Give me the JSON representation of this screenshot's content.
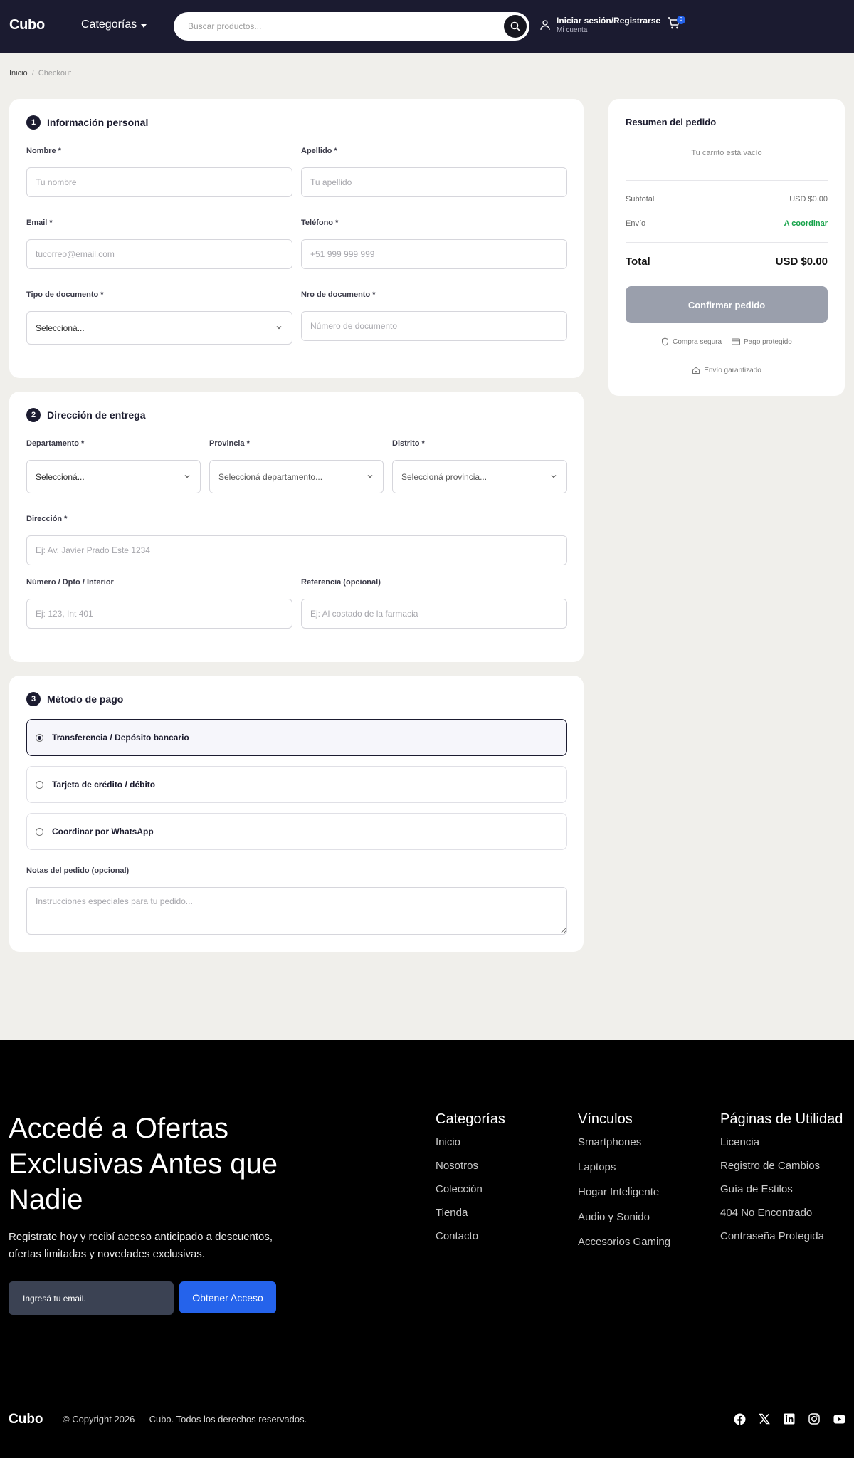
{
  "header": {
    "logo": "Cubo",
    "categories_label": "Categorías",
    "search_placeholder": "Buscar productos...",
    "account_title": "Iniciar sesión/Registrarse",
    "account_sub": "Mi cuenta",
    "cart_count": "0"
  },
  "breadcrumb": {
    "home": "Inicio",
    "separator": "/",
    "current": "Checkout"
  },
  "personal": {
    "step": "1",
    "title": "Información personal",
    "nombre_label": "Nombre *",
    "nombre_ph": "Tu nombre",
    "apellido_label": "Apellido *",
    "apellido_ph": "Tu apellido",
    "email_label": "Email *",
    "email_ph": "tucorreo@email.com",
    "telefono_label": "Teléfono *",
    "telefono_ph": "+51 999 999 999",
    "tipo_label": "Tipo de documento *",
    "tipo_value": "Seleccioná...",
    "nro_label": "Nro de documento *",
    "nro_ph": "Número de documento"
  },
  "delivery": {
    "step": "2",
    "title": "Dirección de entrega",
    "depto_label": "Departamento *",
    "depto_value": "Seleccioná...",
    "provincia_label": "Provincia *",
    "provincia_value": "Seleccioná departamento...",
    "distrito_label": "Distrito *",
    "distrito_value": "Seleccioná provincia...",
    "direccion_label": "Dirección *",
    "direccion_ph": "Ej: Av. Javier Prado Este 1234",
    "numero_label": "Número / Dpto / Interior",
    "numero_ph": "Ej: 123, Int 401",
    "referencia_label": "Referencia (opcional)",
    "referencia_ph": "Ej: Al costado de la farmacia"
  },
  "payment": {
    "step": "3",
    "title": "Método de pago",
    "options": [
      {
        "label": "Transferencia / Depósito bancario",
        "selected": true
      },
      {
        "label": "Tarjeta de crédito / débito",
        "selected": false
      },
      {
        "label": "Coordinar por WhatsApp",
        "selected": false
      }
    ],
    "notes_label": "Notas del pedido (opcional)",
    "notes_ph": "Instrucciones especiales para tu pedido..."
  },
  "summary": {
    "title": "Resumen del pedido",
    "empty": "Tu carrito está vacío",
    "subtotal_label": "Subtotal",
    "subtotal_value": "USD $0.00",
    "envio_label": "Envío",
    "envio_value": "A coordinar",
    "total_label": "Total",
    "total_value": "USD $0.00",
    "confirm": "Confirmar pedido",
    "trust_1": "Compra segura",
    "trust_2": "Pago protegido",
    "trust_3": "Envío garantizado",
    "accent_green": "#16a34a"
  },
  "footer": {
    "headline": "Accedé a Ofertas Exclusivas Antes que Nadie",
    "subtitle": "Registrate hoy y recibí acceso anticipado a descuentos, ofertas limitadas y novedades exclusivas.",
    "email_ph": "Ingresá tu email.",
    "cta": "Obtener Acceso",
    "cta_color": "#2563eb",
    "col1": {
      "title": "Categorías",
      "links": [
        "Inicio",
        "Nosotros",
        "Colección",
        "Tienda",
        "Contacto"
      ]
    },
    "col2": {
      "title": "Vínculos",
      "links": [
        "Smartphones",
        "Laptops",
        "Hogar Inteligente",
        "Audio y Sonido",
        "Accesorios Gaming"
      ]
    },
    "col3": {
      "title": "Páginas de Utilidad",
      "links": [
        "Licencia",
        "Registro de Cambios",
        "Guía de Estilos",
        "404 No Encontrado",
        "Contraseña Protegida"
      ]
    },
    "logo": "Cubo",
    "copyright": "© Copyright 2026 — Cubo. Todos los derechos reservados.",
    "socials": [
      "facebook-icon",
      "x-icon",
      "linkedin-icon",
      "instagram-icon",
      "youtube-icon"
    ]
  }
}
